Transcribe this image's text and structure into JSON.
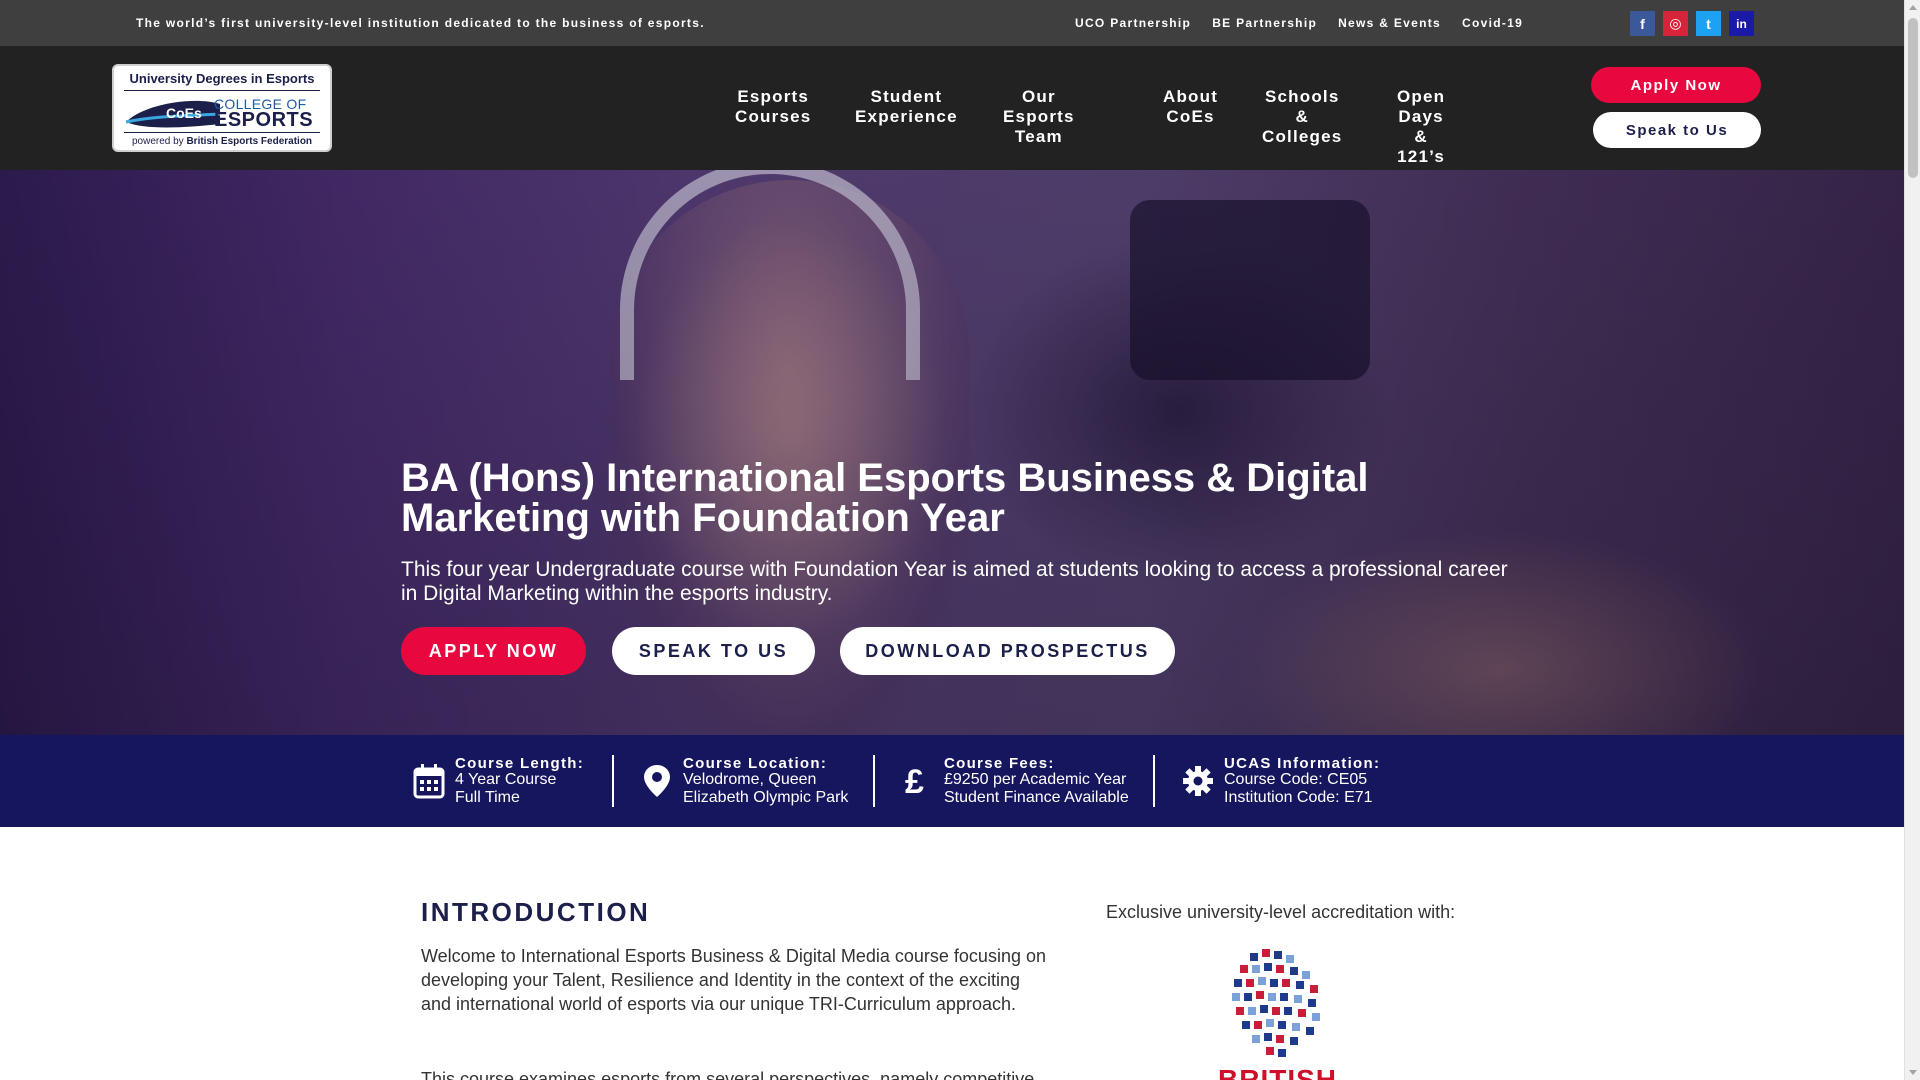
{
  "topbar": {
    "tagline": "The world’s first university-level institution dedicated to the business of esports.",
    "links": [
      "UCO Partnership",
      "BE Partnership",
      "News & Events",
      "Covid-19"
    ],
    "social": [
      {
        "name": "facebook-icon",
        "glyph": "f",
        "color": "#3b5998"
      },
      {
        "name": "instagram-icon",
        "glyph": "◎",
        "color": "#d6243a"
      },
      {
        "name": "twitter-icon",
        "glyph": "t",
        "color": "#1da1f2"
      },
      {
        "name": "linkedin-icon",
        "glyph": "in",
        "color": "#1a1aa6"
      }
    ]
  },
  "logo": {
    "top": "University Degrees in Esports",
    "badge": "CoEs",
    "college": "COLLEGE OF",
    "esports": "ESPORTS",
    "powered_prefix": "powered by ",
    "powered_org": "British Esports Federation"
  },
  "nav": [
    {
      "label": "Esports\nCourses"
    },
    {
      "label": "Student\nExperience"
    },
    {
      "label": "Our\nEsports Team"
    },
    {
      "label": "About\nCoEs"
    },
    {
      "label": "Schools\n& Colleges"
    },
    {
      "label": "Open Days\n& 121’s"
    }
  ],
  "header_buttons": {
    "apply": "Apply Now",
    "speak": "Speak to Us"
  },
  "hero": {
    "title": "BA (Hons) International Esports Business & Digital Marketing with Foundation Year",
    "description": "This four year Undergraduate course with Foundation Year is aimed at students looking to access a professional career in Digital Marketing within the esports industry.",
    "cta_apply": "APPLY NOW",
    "cta_speak": "SPEAK TO US",
    "cta_download": "DOWNLOAD PROSPECTUS"
  },
  "info": [
    {
      "icon": "calendar-icon",
      "title": "Course Length:",
      "lines": [
        "4 Year Course",
        "Full Time"
      ]
    },
    {
      "icon": "location-pin-icon",
      "title": "Course Location:",
      "lines": [
        "Velodrome, Queen",
        "Elizabeth Olympic Park"
      ]
    },
    {
      "icon": "pound-icon",
      "title": "Course Fees:",
      "lines": [
        "£9250 per Academic Year",
        "Student Finance Available"
      ]
    },
    {
      "icon": "gear-icon",
      "title": "UCAS Information:",
      "lines": [
        "Course Code: CE05",
        "Institution Code: E71"
      ]
    }
  ],
  "intro": {
    "heading": "INTRODUCTION",
    "paragraph1": "Welcome to International Esports Business & Digital Media course focusing on developing your Talent, Resilience and Identity in the context of the exciting and international world of esports via our unique TRI-Curriculum approach.",
    "paragraph2": "This course examines esports from several perspectives, namely competitive"
  },
  "accreditation": {
    "label": "Exclusive university-level accreditation with:",
    "logo_text": "BRITISH"
  },
  "colors": {
    "brand_red": "#e8083f",
    "brand_navy": "#16165e",
    "header_bg": "#222222",
    "topbar_bg": "#3f3f3f"
  }
}
